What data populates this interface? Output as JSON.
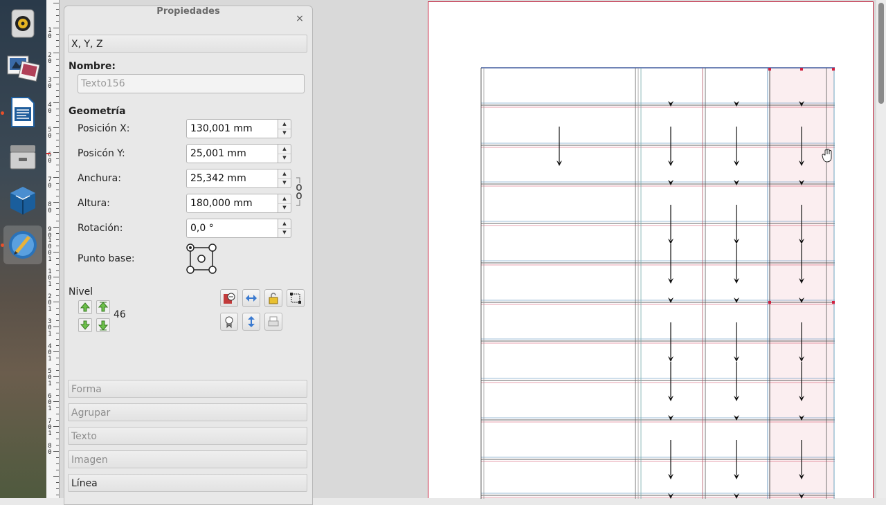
{
  "panel": {
    "title": "Propiedades",
    "close_symbol": "×",
    "xyz_section": "X, Y, Z",
    "name_label": "Nombre:",
    "name_value": "Texto156",
    "geometry_label": "Geometría",
    "fields": [
      {
        "label": "Posición X:",
        "value": "130,001 mm"
      },
      {
        "label": "Posicón Y:",
        "value": "25,001 mm"
      },
      {
        "label": "Anchura:",
        "value": "25,342 mm"
      },
      {
        "label": "Altura:",
        "value": "180,000 mm"
      },
      {
        "label": "Rotación:",
        "value": "0,0 °"
      }
    ],
    "base_point_label": "Punto base:",
    "level_label": "Nivel",
    "level_value": "46",
    "sections": [
      "Forma",
      "Agrupar",
      "Texto",
      "Imagen",
      "Línea"
    ]
  },
  "ruler": {
    "numbers": [
      "1",
      "0",
      "2",
      "0",
      "3",
      "0",
      "4",
      "0",
      "5",
      "0",
      "6",
      "0",
      "7",
      "0",
      "8",
      "0",
      "9",
      "0",
      "1",
      "0",
      "0",
      "1",
      "1",
      "0",
      "1",
      "2",
      "0",
      "1",
      "3",
      "0",
      "1",
      "4",
      "0",
      "1",
      "5",
      "0",
      "1",
      "6",
      "0",
      "1",
      "7",
      "0",
      "1",
      "8",
      "0"
    ]
  },
  "dock": {
    "apps": [
      "sound-icon",
      "image-viewer-icon",
      "writer-icon",
      "file-manager-icon",
      "virtualbox-icon",
      "scribus-icon"
    ]
  },
  "colors": {
    "page_border": "#c41e3a",
    "selected_column": "#fbeef0",
    "grid_red": "#d0405a",
    "grid_blue": "#3a7ab0"
  }
}
